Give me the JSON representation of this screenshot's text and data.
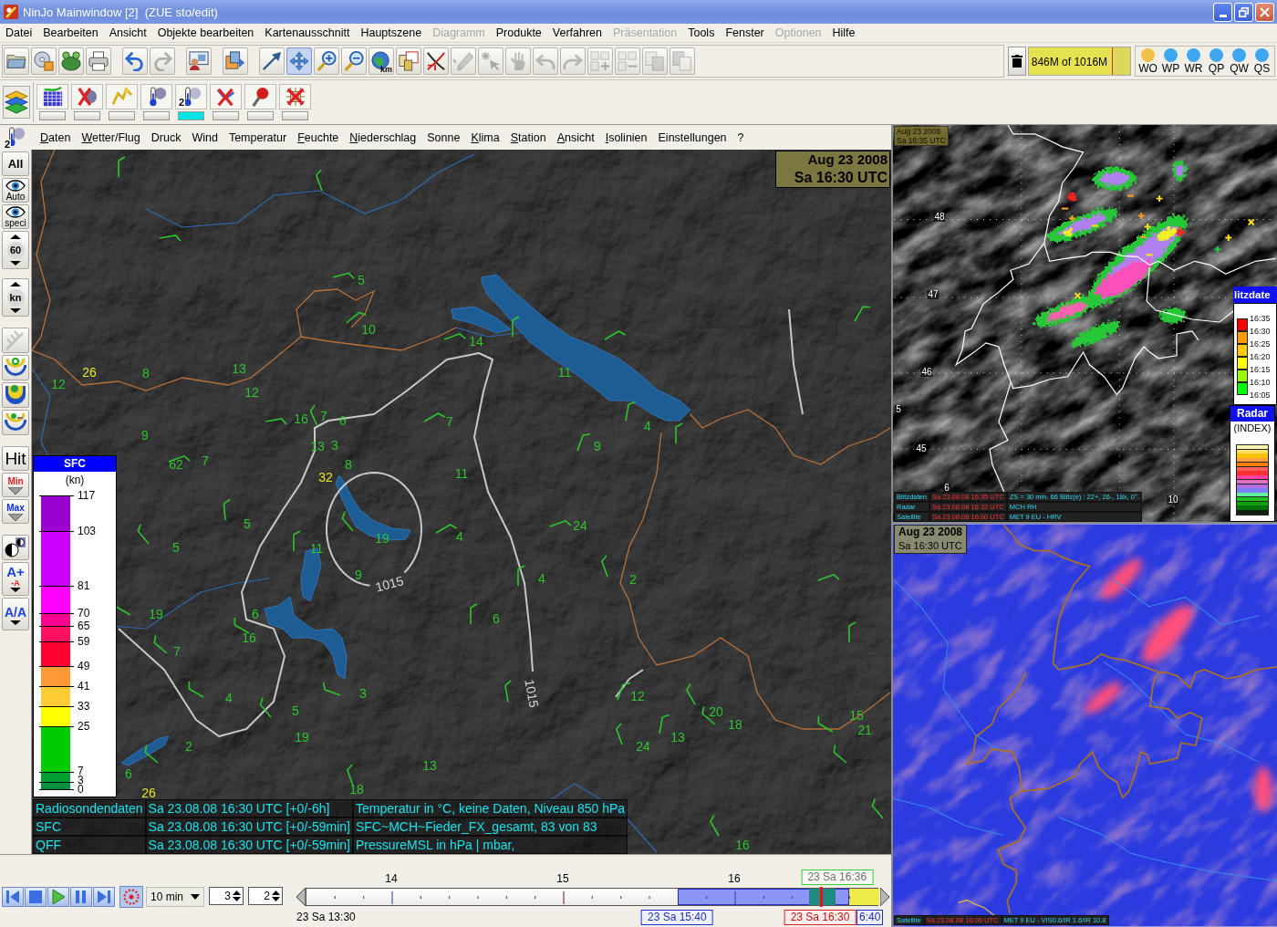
{
  "window": {
    "title": "NinJo Mainwindow [2]  (ZUE sto/edit)"
  },
  "menu": [
    {
      "label": "Datei",
      "disabled": false
    },
    {
      "label": "Bearbeiten",
      "disabled": false
    },
    {
      "label": "Ansicht",
      "disabled": false
    },
    {
      "label": "Objekte bearbeiten",
      "disabled": false
    },
    {
      "label": "Kartenausschnitt",
      "disabled": false
    },
    {
      "label": "Hauptszene",
      "disabled": false
    },
    {
      "label": "Diagramm",
      "disabled": true
    },
    {
      "label": "Produkte",
      "disabled": false
    },
    {
      "label": "Verfahren",
      "disabled": false
    },
    {
      "label": "Präsentation",
      "disabled": true
    },
    {
      "label": "Tools",
      "disabled": false
    },
    {
      "label": "Fenster",
      "disabled": false
    },
    {
      "label": "Optionen",
      "disabled": true
    },
    {
      "label": "Hilfe",
      "disabled": false
    }
  ],
  "main_toolbar": [
    {
      "selected": false,
      "disabled": false
    },
    {
      "selected": false,
      "disabled": false
    },
    {
      "selected": false,
      "disabled": false
    },
    {
      "selected": false,
      "disabled": false
    },
    {
      "selected": false,
      "disabled": false
    },
    {
      "selected": false,
      "disabled": true
    },
    {
      "selected": false,
      "disabled": false
    },
    {
      "selected": false,
      "disabled": false
    },
    {
      "selected": false,
      "disabled": false
    },
    {
      "selected": true,
      "disabled": false
    },
    {
      "selected": false,
      "disabled": false
    },
    {
      "selected": false,
      "disabled": false
    },
    {
      "selected": false,
      "disabled": false,
      "badge": "km"
    },
    {
      "selected": false,
      "disabled": false
    },
    {
      "selected": false,
      "disabled": false
    },
    {
      "selected": false,
      "disabled": true
    },
    {
      "selected": false,
      "disabled": true
    },
    {
      "selected": false,
      "disabled": true
    },
    {
      "selected": false,
      "disabled": true
    },
    {
      "selected": false,
      "disabled": true
    },
    {
      "selected": false,
      "disabled": true
    },
    {
      "selected": false,
      "disabled": true
    },
    {
      "selected": false,
      "disabled": true
    },
    {
      "selected": false,
      "disabled": true
    }
  ],
  "memory": {
    "label": "846M of 1016M",
    "level": 0.83
  },
  "status_lights": [
    {
      "label": "WO",
      "color": "#f2c046"
    },
    {
      "label": "WP",
      "color": "#3ea6ee"
    },
    {
      "label": "WR",
      "color": "#3ea6ee"
    },
    {
      "label": "QP",
      "color": "#3ea6ee"
    },
    {
      "label": "QW",
      "color": "#3ea6ee"
    },
    {
      "label": "QS",
      "color": "#3ea6ee"
    }
  ],
  "layer_buttons": [
    {
      "selected": false
    },
    {
      "selected": false
    },
    {
      "selected": false
    },
    {
      "selected": false
    },
    {
      "selected": true,
      "badge": "2"
    },
    {
      "selected": false
    },
    {
      "selected": false
    },
    {
      "selected": false
    }
  ],
  "map_panel": {
    "layer_icon_badge": "2",
    "menu": [
      {
        "label": "Daten",
        "mnemonic": true
      },
      {
        "label": "Wetter/Flug",
        "mnemonic": true
      },
      {
        "label": "Druck",
        "mnemonic": false
      },
      {
        "label": "Wind",
        "mnemonic": false
      },
      {
        "label": "Temperatur",
        "mnemonic": false
      },
      {
        "label": "Feuchte",
        "mnemonic": true
      },
      {
        "label": "Niederschlag",
        "mnemonic": true
      },
      {
        "label": "Sonne",
        "mnemonic": false
      },
      {
        "label": "Klima",
        "mnemonic": true
      },
      {
        "label": "Station",
        "mnemonic": true
      },
      {
        "label": "Ansicht",
        "mnemonic": true
      },
      {
        "label": "Isolinien",
        "mnemonic": true
      },
      {
        "label": "Einstellungen",
        "mnemonic": false
      },
      {
        "label": "?",
        "mnemonic": false
      }
    ],
    "side_toolbar": [
      {
        "kind": "text",
        "label": "All",
        "disabled": false
      },
      {
        "kind": "eye",
        "label": "Auto",
        "disabled": false
      },
      {
        "kind": "eye",
        "label": "speci",
        "disabled": false
      },
      {
        "kind": "spinner",
        "label": "60",
        "disabled": false
      },
      {
        "kind": "spinner",
        "label": "kn",
        "disabled": false
      },
      {
        "kind": "icon",
        "disabled": true
      },
      {
        "kind": "icon",
        "disabled": false
      },
      {
        "kind": "icon",
        "disabled": false
      },
      {
        "kind": "icon",
        "disabled": false
      },
      {
        "kind": "text",
        "label": "Hit",
        "disabled": false
      },
      {
        "kind": "arrow",
        "label": "Min",
        "color": "#e02020",
        "disabled": false
      },
      {
        "kind": "arrow",
        "label": "Max",
        "color": "#1030e0",
        "disabled": false
      },
      {
        "kind": "icon",
        "disabled": false
      },
      {
        "kind": "font_size",
        "label": "A+",
        "sublabel": "-A",
        "disabled": false
      },
      {
        "kind": "font_toggle",
        "label": "A/A",
        "disabled": false
      }
    ],
    "timestamp": {
      "date": "Aug 23 2008",
      "time": "Sa 16:30 UTC"
    },
    "station_values": [
      {
        "value": "5",
        "color": "#2ec42e"
      },
      {
        "value": "10",
        "color": "#2ec42e"
      },
      {
        "value": "14",
        "color": "#2ec42e"
      },
      {
        "value": "26",
        "color": "#e6e62a"
      },
      {
        "value": "8",
        "color": "#2ec42e"
      },
      {
        "value": "13",
        "color": "#2ec42e"
      },
      {
        "value": "11",
        "color": "#2ec42e"
      },
      {
        "value": "12",
        "color": "#2ec42e"
      },
      {
        "value": "12",
        "color": "#2ec42e"
      },
      {
        "value": "16",
        "color": "#2ec42e"
      },
      {
        "value": "7",
        "color": "#2ec42e"
      },
      {
        "value": "6",
        "color": "#2ec42e"
      },
      {
        "value": "7",
        "color": "#2ec42e"
      },
      {
        "value": "4",
        "color": "#2ec42e"
      },
      {
        "value": "9",
        "color": "#2ec42e"
      },
      {
        "value": "13",
        "color": "#2ec42e"
      },
      {
        "value": "3",
        "color": "#2ec42e"
      },
      {
        "value": "9",
        "color": "#2ec42e"
      },
      {
        "value": "62",
        "color": "#2ec42e"
      },
      {
        "value": "7",
        "color": "#2ec42e"
      },
      {
        "value": "8",
        "color": "#2ec42e"
      },
      {
        "value": "32",
        "color": "#e6e62a"
      },
      {
        "value": "11",
        "color": "#2ec42e"
      },
      {
        "value": "5",
        "color": "#2ec42e"
      },
      {
        "value": "24",
        "color": "#2ec42e"
      },
      {
        "value": "19",
        "color": "#2ec42e"
      },
      {
        "value": "4",
        "color": "#2ec42e"
      },
      {
        "value": "5",
        "color": "#2ec42e"
      },
      {
        "value": "11",
        "color": "#2ec42e"
      },
      {
        "value": "9",
        "color": "#2ec42e"
      },
      {
        "value": "4",
        "color": "#2ec42e"
      },
      {
        "value": "2",
        "color": "#2ec42e"
      },
      {
        "value": "19",
        "color": "#2ec42e"
      },
      {
        "value": "6",
        "color": "#2ec42e"
      },
      {
        "value": "6",
        "color": "#2ec42e"
      },
      {
        "value": "16",
        "color": "#2ec42e"
      },
      {
        "value": "7",
        "color": "#2ec42e"
      },
      {
        "value": "4",
        "color": "#2ec42e"
      },
      {
        "value": "3",
        "color": "#2ec42e"
      },
      {
        "value": "12",
        "color": "#2ec42e"
      },
      {
        "value": "5",
        "color": "#2ec42e"
      },
      {
        "value": "20",
        "color": "#2ec42e"
      },
      {
        "value": "15",
        "color": "#2ec42e"
      },
      {
        "value": "18",
        "color": "#2ec42e"
      },
      {
        "value": "21",
        "color": "#2ec42e"
      },
      {
        "value": "19",
        "color": "#2ec42e"
      },
      {
        "value": "13",
        "color": "#2ec42e"
      },
      {
        "value": "2",
        "color": "#2ec42e"
      },
      {
        "value": "24",
        "color": "#2ec42e"
      },
      {
        "value": "13",
        "color": "#2ec42e"
      },
      {
        "value": "6",
        "color": "#2ec42e"
      },
      {
        "value": "26",
        "color": "#e6e62a"
      },
      {
        "value": "18",
        "color": "#2ec42e"
      },
      {
        "value": "16",
        "color": "#2ec42e"
      }
    ],
    "isobar_labels": [
      "1015",
      "1015"
    ],
    "legend": {
      "title": "SFC",
      "unit": "(kn)",
      "ticks": [
        "117",
        "103",
        "81",
        "70",
        "65",
        "59",
        "49",
        "41",
        "33",
        "25",
        "7",
        "3",
        "0"
      ],
      "bands": [
        {
          "color": "#9a00d0"
        },
        {
          "color": "#cc00ff"
        },
        {
          "color": "#ff00ff"
        },
        {
          "color": "#ff0090"
        },
        {
          "color": "#ff1060"
        },
        {
          "color": "#ff0030"
        },
        {
          "color": "#ff9933"
        },
        {
          "color": "#ffcc33"
        },
        {
          "color": "#ffff00"
        },
        {
          "color": "#00cc00"
        },
        {
          "color": "#00a030"
        },
        {
          "color": "#009040"
        }
      ]
    },
    "info_rows": [
      [
        "Radiosondendaten",
        "Sa 23.08.08 16:30 UTC [+0/-6h]",
        "Temperatur in °C, keine Daten, Niveau 850 hPa"
      ],
      [
        "SFC",
        "Sa 23.08.08 16:30 UTC [+0/-59min]",
        "SFC~MCH~Fieder_FX_gesamt, 83 von 83"
      ],
      [
        "QFF",
        "Sa 23.08.08 16:30 UTC [+0/-59min]",
        "PressureMSL in hPa | mbar,"
      ]
    ]
  },
  "timeline": {
    "sync_button": {
      "on": true
    },
    "step": "10 min",
    "spinners": [
      "3",
      "2"
    ],
    "hour_labels": [
      "14",
      "15",
      "16"
    ],
    "latest_label": "23 Sa 16:36",
    "start_label": "23 Sa 13:30",
    "range_start_label": "23 Sa 15:40",
    "current_label": "23 Sa 16:30",
    "range_end_label": "6:40"
  },
  "satellite_panel": {
    "timestamp": {
      "date": "Aug 23 2008",
      "time": "Sa 16:35 UTC"
    },
    "grid_labels": [
      "48",
      "47",
      "46",
      "45",
      "5",
      "6",
      "10"
    ],
    "lightning_legend": {
      "title": "litzdate",
      "ticks": [
        "16:35",
        "16:30",
        "16:25",
        "16:20",
        "16:15",
        "16:10",
        "16:05"
      ],
      "bands": [
        {
          "color": "#ff0000"
        },
        {
          "color": "#ff9900"
        },
        {
          "color": "#ffcc00"
        },
        {
          "color": "#ffff00"
        },
        {
          "color": "#99ff00"
        },
        {
          "color": "#00ff00"
        }
      ]
    },
    "radar_legend": {
      "title": "Radar",
      "unit": "(INDEX)"
    },
    "info_rows": [
      [
        "Blitzdaten",
        "Sa 23.08.08 16:35 UTC",
        "ZS = 30 min. 66 Blitz(e) : 22+, 26-, 18x, 0°."
      ],
      [
        "Radar",
        "Sa 23.08.08 16:32 UTC",
        "MCH RH"
      ],
      [
        "Satellite",
        "Sa 23.08.08 16:00 UTC",
        "MET 9 EU - HRV"
      ]
    ]
  },
  "composite_panel": {
    "timestamp": {
      "date": "Aug 23 2008",
      "time": "Sa 16:30 UTC"
    },
    "info_row": [
      "Satellite",
      "Sa 23.08.08 16:00 UTC",
      "MET 9 EU - VIS0.6/IR 1.6/IR 10.8"
    ]
  }
}
